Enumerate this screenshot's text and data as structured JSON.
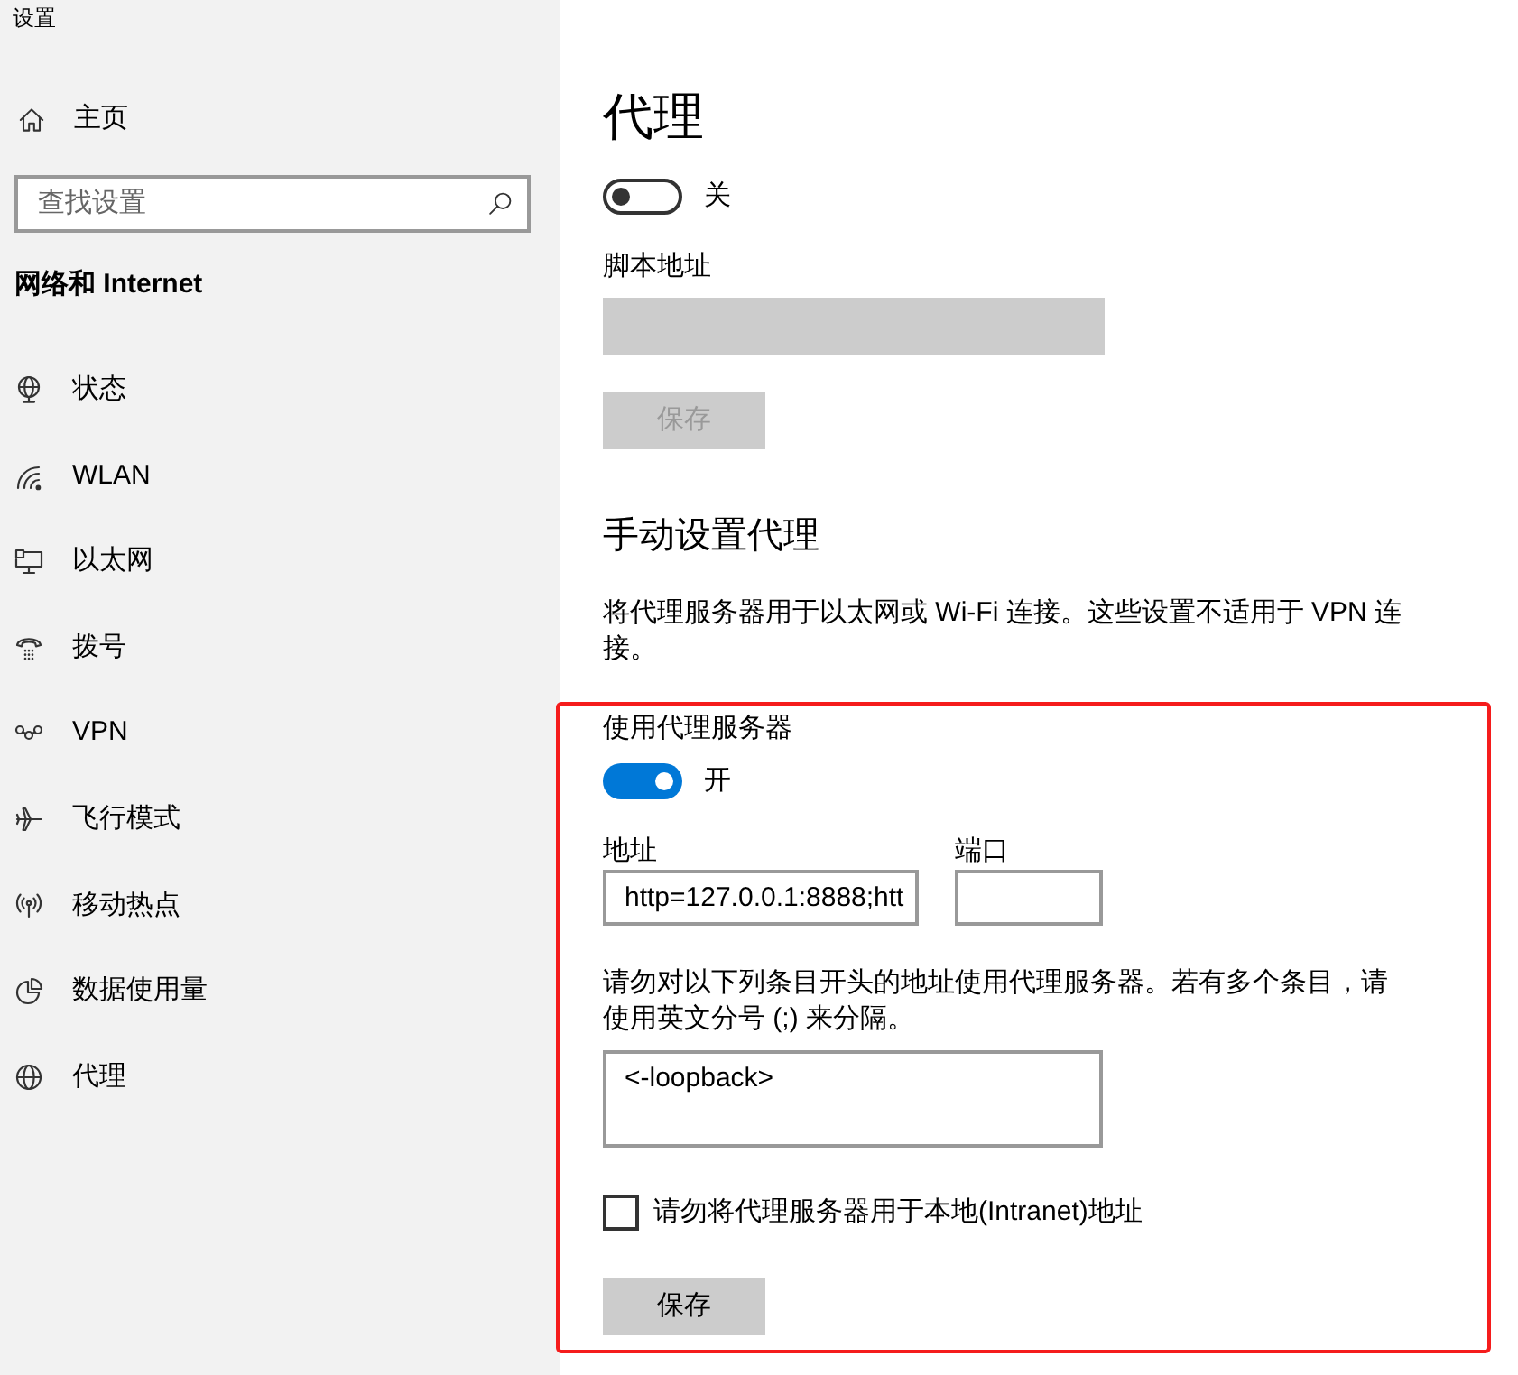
{
  "window": {
    "title": "设置"
  },
  "sidebar": {
    "home": {
      "label": "主页"
    },
    "search": {
      "placeholder": "查找设置"
    },
    "section_title": "网络和 Internet",
    "items": [
      {
        "label": "状态"
      },
      {
        "label": "WLAN"
      },
      {
        "label": "以太网"
      },
      {
        "label": "拨号"
      },
      {
        "label": "VPN"
      },
      {
        "label": "飞行模式"
      },
      {
        "label": "移动热点"
      },
      {
        "label": "数据使用量"
      },
      {
        "label": "代理"
      }
    ]
  },
  "page": {
    "title": "代理",
    "automatic": {
      "toggle": {
        "on": false,
        "label": "关"
      },
      "script_address": {
        "label": "脚本地址",
        "disabled": true
      },
      "save_button": {
        "label": "保存",
        "disabled": true
      }
    },
    "manual": {
      "heading": "手动设置代理",
      "description": "将代理服务器用于以太网或 Wi-Fi 连接。这些设置不适用于 VPN 连接。",
      "proxy_server": {
        "highlighted": true,
        "label": "使用代理服务器",
        "toggle": {
          "on": true,
          "label": "开"
        },
        "address": {
          "label": "地址",
          "value": "http=127.0.0.1:8888;htt"
        },
        "port": {
          "label": "端口"
        },
        "exceptions": {
          "description": "请勿对以下列条目开头的地址使用代理服务器。若有多个条目，请使用英文分号 (;) 来分隔。",
          "value": "<-loopback>"
        },
        "bypass_local": {
          "label": "请勿将代理服务器用于本地(Intranet)地址",
          "checked": false
        },
        "save_button": {
          "label": "保存",
          "disabled": false
        }
      }
    }
  }
}
